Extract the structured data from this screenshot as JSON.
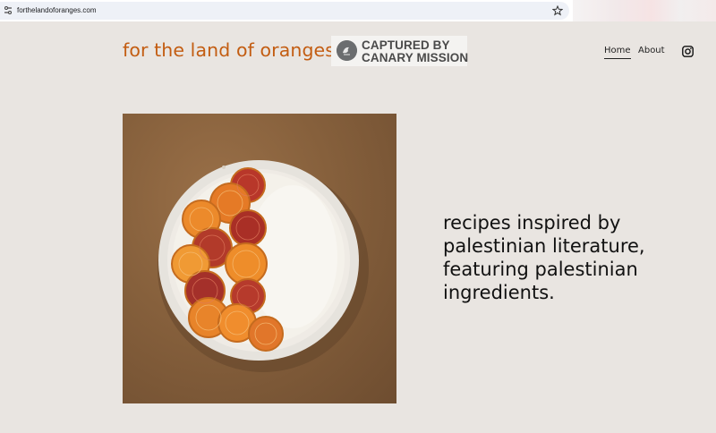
{
  "browser": {
    "url": "forthelandoforanges.com"
  },
  "header": {
    "site_title": "for the land of oranges",
    "badge": {
      "line1": "CAPTURED BY",
      "line2": "CANARY MISSION"
    },
    "nav": {
      "home": "Home",
      "about": "About"
    }
  },
  "hero": {
    "text": "recipes inspired by palestinian literature, featuring palestinian ingredients."
  },
  "colors": {
    "title": "#c35d12",
    "background": "#e9e5e1",
    "text": "#111111"
  },
  "icons": [
    "site-info-icon",
    "bookmark-star-icon",
    "canary-mission-logo-icon",
    "instagram-icon"
  ]
}
